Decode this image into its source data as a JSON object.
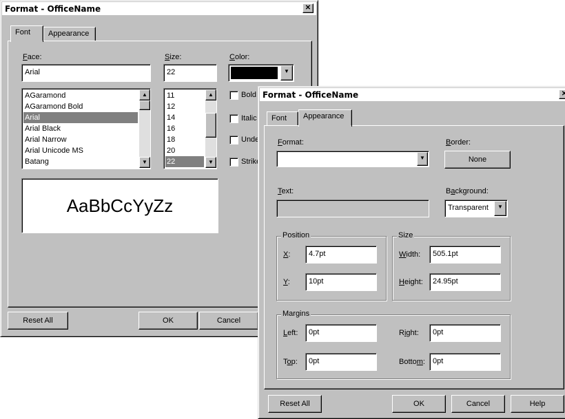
{
  "win1": {
    "title": "Format - OfficeName",
    "close_glyph": "✕",
    "tabs": {
      "font": "Font",
      "appearance": "Appearance"
    },
    "face": {
      "label": "Face:",
      "value": "Arial",
      "list": [
        "AGaramond",
        "AGaramond Bold",
        "Arial",
        "Arial Black",
        "Arial Narrow",
        "Arial Unicode MS",
        "Batang"
      ],
      "selected_index": 2
    },
    "size": {
      "label": "Size:",
      "value": "22",
      "list": [
        "11",
        "12",
        "14",
        "16",
        "18",
        "20",
        "22"
      ],
      "selected_index": 6
    },
    "color": {
      "label": "Color:",
      "swatch": "#000000"
    },
    "checkboxes": [
      "Bold",
      "Italic",
      "Underline",
      "Strikeout"
    ],
    "preview": "AaBbCcYyZz",
    "buttons": {
      "reset": "Reset All",
      "ok": "OK",
      "cancel": "Cancel"
    }
  },
  "win2": {
    "title": "Format - OfficeName",
    "close_glyph": "✕",
    "tabs": {
      "font": "Font",
      "appearance": "Appearance"
    },
    "format": {
      "label": "Format:",
      "value": ""
    },
    "border": {
      "label": "Border:",
      "button": "None"
    },
    "text": {
      "label": "Text:",
      "value": ""
    },
    "background": {
      "label": "Background:",
      "value": "Transparent"
    },
    "position": {
      "legend": "Position",
      "x_label": "X:",
      "x_value": "4.7pt",
      "y_label": "Y:",
      "y_value": "10pt"
    },
    "size": {
      "legend": "Size",
      "width_label": "Width:",
      "width_value": "505.1pt",
      "height_label": "Height:",
      "height_value": "24.95pt"
    },
    "margins": {
      "legend": "Margins",
      "left_label": "Left:",
      "left_value": "0pt",
      "right_label": "Right:",
      "right_value": "0pt",
      "top_label": "Top:",
      "top_value": "0pt",
      "bottom_label": "Bottom:",
      "bottom_value": "0pt"
    },
    "buttons": {
      "reset": "Reset All",
      "ok": "OK",
      "cancel": "Cancel",
      "help": "Help"
    }
  },
  "glyphs": {
    "up": "▲",
    "down": "▼"
  }
}
